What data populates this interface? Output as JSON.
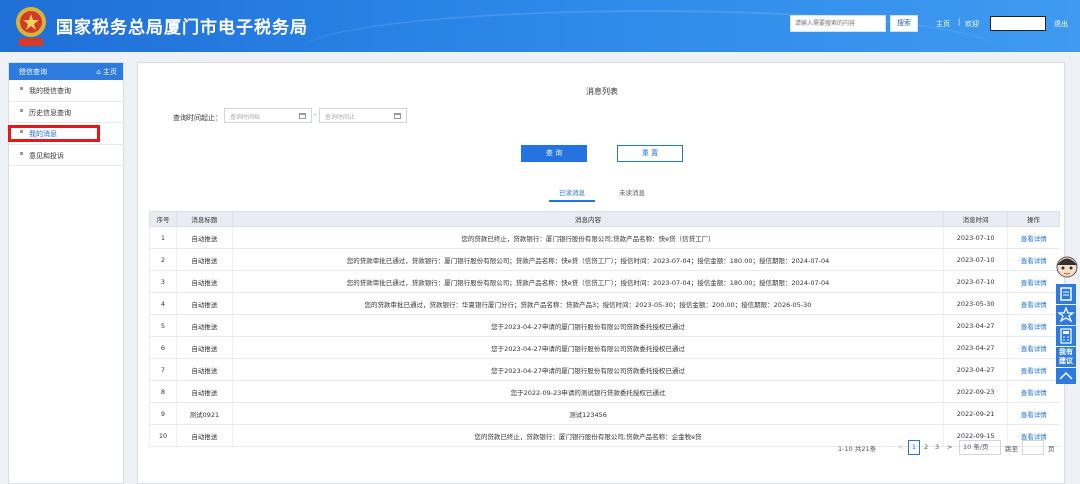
{
  "header": {
    "site_title": "国家税务总局厦门市电子税务局",
    "search_placeholder": "请输入需要搜索的内容",
    "search_button": "搜索",
    "home_link": "主页",
    "separator": "|",
    "welcome": "欢迎",
    "logout": "退出",
    "emblem_icon": "tax-emblem-icon"
  },
  "sidebar": {
    "header_title": "授信查询",
    "header_home": "⌂ 主页",
    "items": [
      {
        "label": "我的授信查询"
      },
      {
        "label": "历史信息查询"
      },
      {
        "label": "我的消息"
      },
      {
        "label": "意见和投诉"
      }
    ]
  },
  "main": {
    "title": "消息列表",
    "query_label": "查询时间起止：",
    "start_placeholder": "查询时间始",
    "end_placeholder": "查询时间止",
    "date_sep": "-",
    "query_button": "查 询",
    "reset_button": "重 置",
    "tab_read": "已读消息",
    "tab_unread": "未读消息"
  },
  "table": {
    "headers": [
      "序号",
      "消息标题",
      "消息内容",
      "消息时间",
      "操作"
    ],
    "rows": [
      {
        "no": "1",
        "title": "自动推送",
        "content": "您的贷款已终止，贷款银行：厦门银行股份有限公司;贷款产品名称：快e贷（信贷工厂）",
        "time": "2023-07-10",
        "op": "查看详情"
      },
      {
        "no": "2",
        "title": "自动推送",
        "content": "您的贷款审批已通过，贷款银行：厦门银行股份有限公司；贷款产品名称：快e贷（信贷工厂）；授信时间：2023-07-04；授信金额：180.00；授信期限：2024-07-04",
        "time": "2023-07-10",
        "op": "查看详情"
      },
      {
        "no": "3",
        "title": "自动推送",
        "content": "您的贷款审批已通过，贷款银行：厦门银行股份有限公司；贷款产品名称：快e贷（信贷工厂）；授信时间：2023-07-04；授信金额：180.00；授信期限：2024-07-04",
        "time": "2023-07-10",
        "op": "查看详情"
      },
      {
        "no": "4",
        "title": "自动推送",
        "content": "您的贷款审批已通过，贷款银行：华夏银行厦门分行；贷款产品名称：贷款产品3；授信时间：2023-05-30；授信金额：200.00；授信期限：2026-05-30",
        "time": "2023-05-30",
        "op": "查看详情"
      },
      {
        "no": "5",
        "title": "自动推送",
        "content": "您于2023-04-27申请的厦门银行股份有限公司贷款委托授权已通过",
        "time": "2023-04-27",
        "op": "查看详情"
      },
      {
        "no": "6",
        "title": "自动推送",
        "content": "您于2023-04-27申请的厦门银行股份有限公司贷款委托授权已通过",
        "time": "2023-04-27",
        "op": "查看详情"
      },
      {
        "no": "7",
        "title": "自动推送",
        "content": "您于2023-04-27申请的厦门银行股份有限公司贷款委托授权已通过",
        "time": "2023-04-27",
        "op": "查看详情"
      },
      {
        "no": "8",
        "title": "自动推送",
        "content": "您于2022-09-23申请的测试银行贷款委托授权已通过",
        "time": "2022-09-23",
        "op": "查看详情"
      },
      {
        "no": "9",
        "title": "测试0921",
        "content": "测试123456",
        "time": "2022-09-21",
        "op": "查看详情"
      },
      {
        "no": "10",
        "title": "自动推送",
        "content": "您的贷款已终止，贷款银行：厦门银行股份有限公司;贷款产品名称：企金税e贷",
        "time": "2022-09-15",
        "op": "查看详情"
      }
    ]
  },
  "pagination": {
    "summary": "1-10 共21条",
    "prev": "<",
    "pages": [
      "1",
      "2",
      "3"
    ],
    "next": ">",
    "page_size": "10 条/页",
    "goto_label": "跳至",
    "goto_suffix": "页"
  },
  "float_tools": {
    "suggest": "我有建议",
    "icons": [
      "customer-service-icon",
      "document-icon",
      "star-icon",
      "calculator-icon",
      "suggest-icon",
      "scroll-top-icon"
    ]
  },
  "colors": {
    "header_blue": "#2b86e8",
    "accent": "#2473e0",
    "highlight_red": "#e5171b"
  }
}
